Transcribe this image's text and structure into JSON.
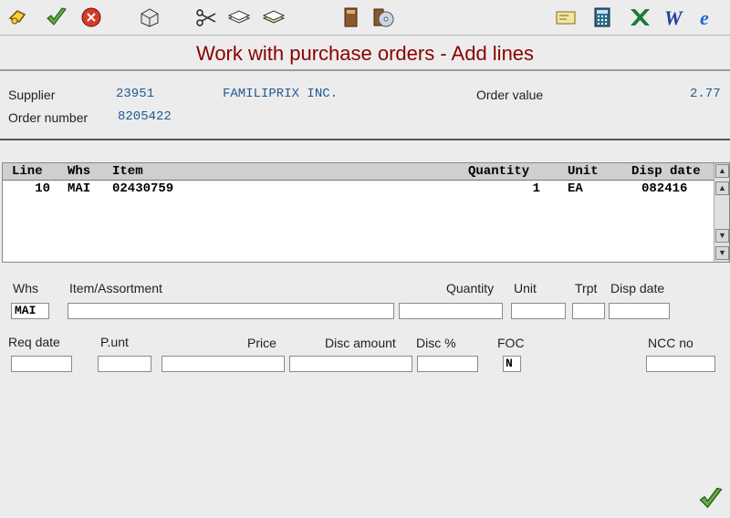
{
  "title": "Work with purchase orders - Add lines",
  "header": {
    "supplier_label": "Supplier",
    "supplier_code": "23951",
    "supplier_name": "FAMILIPRIX INC.",
    "order_value_label": "Order value",
    "order_value": "2.77",
    "order_number_label": "Order number",
    "order_number": "8205422"
  },
  "grid": {
    "columns": [
      "Line",
      "Whs",
      "Item",
      "Quantity",
      "Unit",
      "Disp date"
    ],
    "rows": [
      {
        "line": "10",
        "whs": "MAI",
        "item": "02430759",
        "quantity": "1",
        "unit": "EA",
        "disp_date": "082416"
      }
    ]
  },
  "form": {
    "whs_label": "Whs",
    "whs_value": "MAI",
    "item_label": "Item/Assortment",
    "quantity_label": "Quantity",
    "unit_label": "Unit",
    "trpt_label": "Trpt",
    "disp_date_label": "Disp date",
    "req_date_label": "Req date",
    "punt_label": "P.unt",
    "price_label": "Price",
    "disc_amount_label": "Disc amount",
    "disc_pct_label": "Disc %",
    "foc_label": "FOC",
    "foc_value": "N",
    "ncc_label": "NCC no"
  },
  "toolbar_icons": [
    "key-icon",
    "check-icon",
    "cancel-icon",
    "box-icon",
    "scissors-icon",
    "copy-icon",
    "paste-icon",
    "book-icon",
    "cd-icon",
    "mail-icon",
    "calculator-icon",
    "excel-icon",
    "word-icon",
    "browser-icon"
  ],
  "colors": {
    "title": "#8b0000",
    "value": "#1f5a8f",
    "background": "#ececec"
  }
}
